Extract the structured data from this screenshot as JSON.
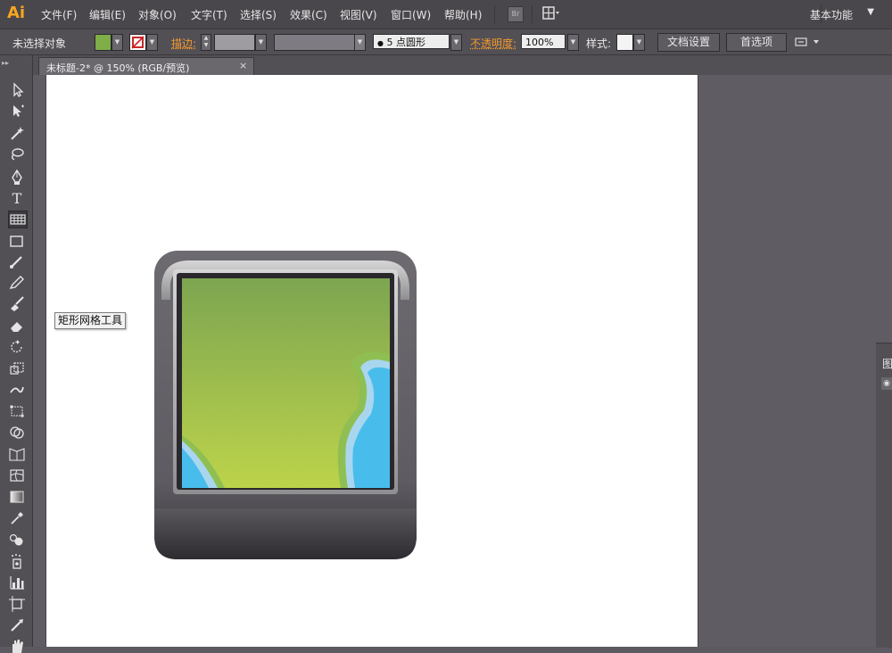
{
  "app": {
    "logo": "Ai"
  },
  "menu": {
    "items": [
      "文件(F)",
      "编辑(E)",
      "对象(O)",
      "文字(T)",
      "选择(S)",
      "效果(C)",
      "视图(V)",
      "窗口(W)",
      "帮助(H)"
    ],
    "bridge": "Br",
    "workspace": "基本功能",
    "workspace_arrow": "▼"
  },
  "control": {
    "selection": "未选择对象",
    "fill_color": "#7fad48",
    "stroke_label": "描边:",
    "brush": "5 点圆形",
    "brush_dot": "●",
    "opacity_label": "不透明度:",
    "opacity": "100%",
    "style_label": "样式:",
    "doc_setup": "文档设置",
    "preferences": "首选项",
    "dropdown": "▼"
  },
  "document": {
    "tab_title": "未标题-2* @ 150% (RGB/预览)",
    "close": "×"
  },
  "toolbox": {
    "grip": "▸▸",
    "tooltip": "矩形网格工具"
  },
  "panel": {
    "label": "图"
  }
}
